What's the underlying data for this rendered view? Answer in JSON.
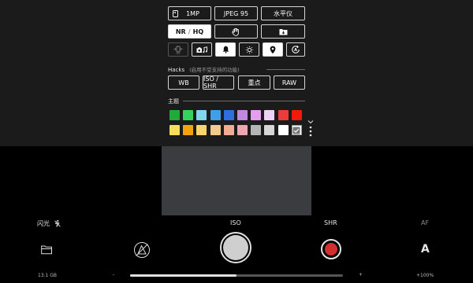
{
  "toolbar_row1": {
    "resolution": "1MP",
    "format": "JPEG 95",
    "level": "水平仪"
  },
  "toolbar_row2": {
    "nr_left": "NR",
    "nr_sep": "/",
    "nr_right": "HQ"
  },
  "hacks": {
    "title": "Hacks",
    "subtitle": "(启用不受支持的功能)",
    "buttons": [
      "WB",
      "ISO / SHR",
      "重点",
      "RAW"
    ]
  },
  "theme": {
    "title": "主题",
    "row1": [
      "#1faa3a",
      "#33d35e",
      "#7fd6ee",
      "#3ea0e8",
      "#2f6ee0",
      "#c288e0",
      "#e69cf0",
      "#edd3f5",
      "#ea3c3c",
      "#f41a0a"
    ],
    "row2": [
      "#f4df5a",
      "#f2a40e",
      "#f6d56a",
      "#f3c98e",
      "#f0ad92",
      "#eea7ae",
      "#b5b5b5",
      "#d6d6d6",
      "#ffffff",
      "#ffffff"
    ],
    "selected_index_row2": 9
  },
  "camera": {
    "flash_label": "闪光",
    "iso_label": "ISO",
    "shr_label": "SHR",
    "af_label": "AF",
    "focus_mode": "A",
    "storage": "13.1 GB",
    "zoom_minus": "-",
    "zoom_plus": "+",
    "zoom_level": "+100%",
    "zoom_fraction": 0.5
  }
}
